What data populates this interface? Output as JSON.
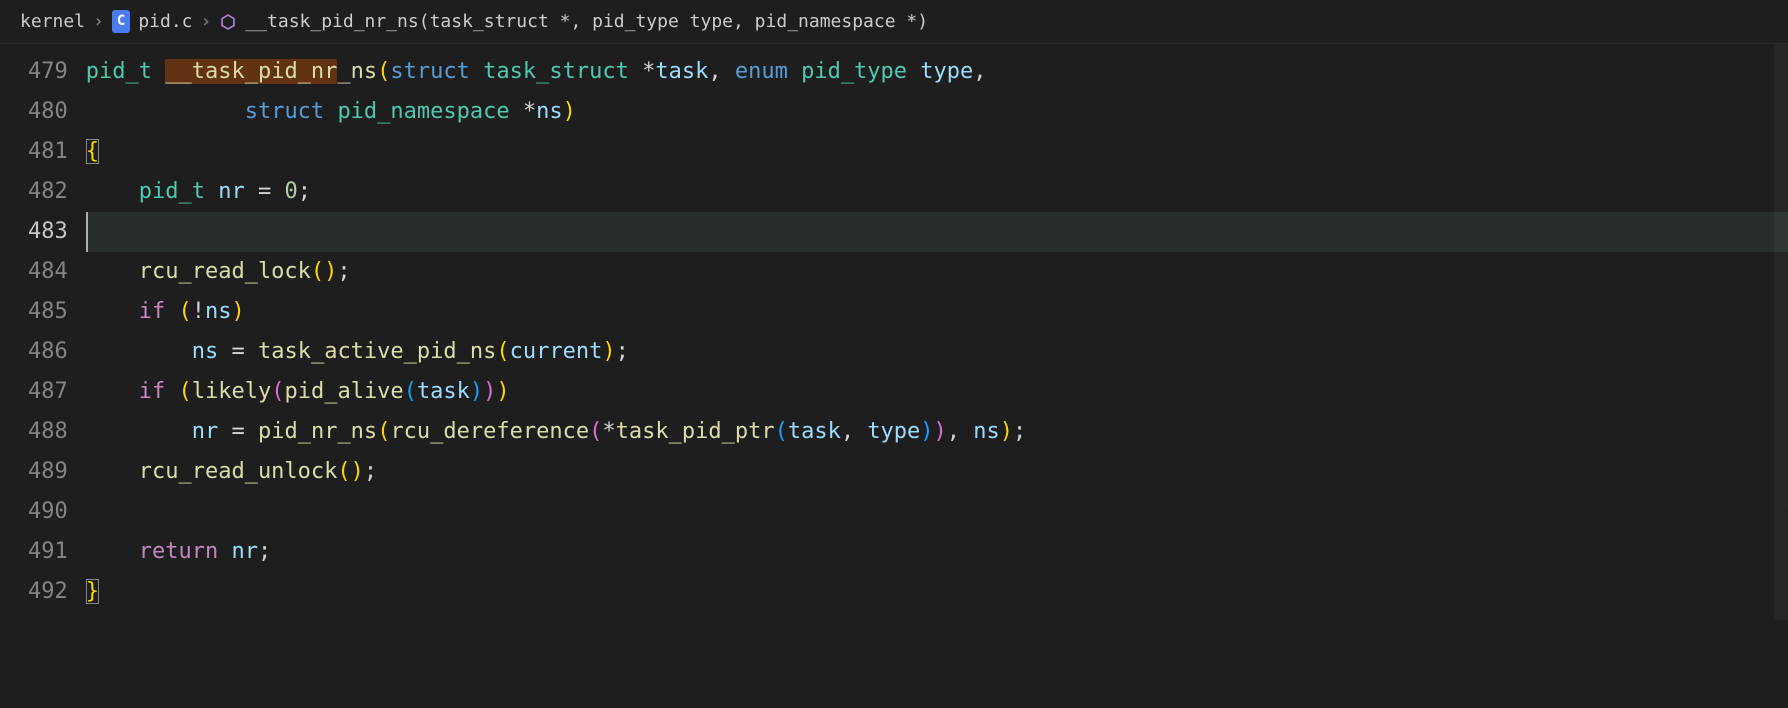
{
  "breadcrumb": {
    "folder": "kernel",
    "file": "pid.c",
    "file_lang_badge": "C",
    "symbol": "__task_pid_nr_ns(task_struct *, pid_type type, pid_namespace *)"
  },
  "line_numbers": [
    "479",
    "480",
    "481",
    "482",
    "483",
    "484",
    "485",
    "486",
    "487",
    "488",
    "489",
    "490",
    "491",
    "492"
  ],
  "active_line_index": 4,
  "code": {
    "l479": {
      "ret_type": "pid_t",
      "fn_hl": "__task_pid_nr",
      "fn_rest": "_ns",
      "kw_struct": "struct",
      "type1": "task_struct",
      "param1": "task",
      "kw_enum": "enum",
      "type2": "pid_type",
      "param2": "type"
    },
    "l480": {
      "kw_struct": "struct",
      "type": "pid_namespace",
      "param": "ns"
    },
    "l481": {
      "brace": "{"
    },
    "l482": {
      "type": "pid_t",
      "var": "nr",
      "eq": "=",
      "val": "0"
    },
    "l484": {
      "fn": "rcu_read_lock"
    },
    "l485": {
      "kw": "if",
      "neg": "!",
      "var": "ns"
    },
    "l486": {
      "var": "ns",
      "eq": "=",
      "fn": "task_active_pid_ns",
      "arg": "current"
    },
    "l487": {
      "kw": "if",
      "fn1": "likely",
      "fn2": "pid_alive",
      "arg": "task"
    },
    "l488": {
      "var": "nr",
      "eq": "=",
      "fn1": "pid_nr_ns",
      "fn2": "rcu_dereference",
      "deref": "*",
      "fn3": "task_pid_ptr",
      "arg1": "task",
      "arg2": "type",
      "arg3": "ns"
    },
    "l489": {
      "fn": "rcu_read_unlock"
    },
    "l491": {
      "kw": "return",
      "var": "nr"
    },
    "l492": {
      "brace": "}"
    }
  }
}
